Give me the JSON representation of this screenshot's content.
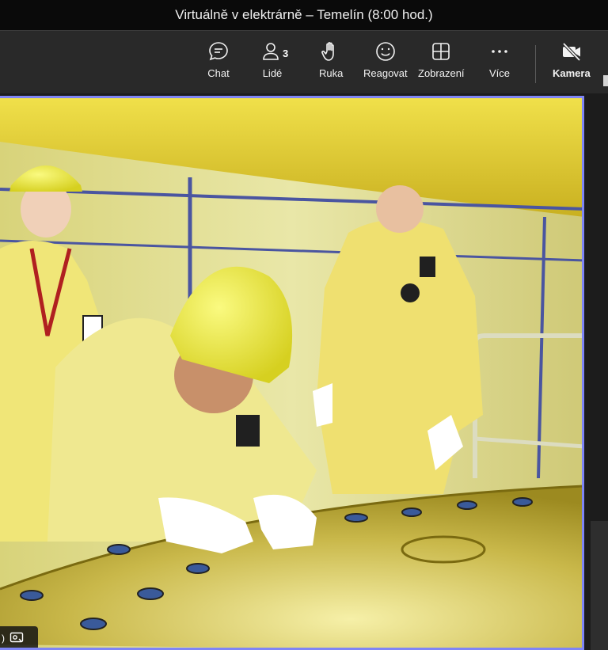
{
  "window": {
    "title": "Virtuálně v elektrárně – Temelín (8:00 hod.)"
  },
  "toolbar": {
    "chat": {
      "label": "Chat",
      "icon": "chat-icon"
    },
    "people": {
      "label": "Lidé",
      "count": "3",
      "icon": "people-icon"
    },
    "raise_hand": {
      "label": "Ruka",
      "icon": "hand-icon"
    },
    "react": {
      "label": "Reagovat",
      "icon": "smiley-icon"
    },
    "view": {
      "label": "Zobrazení",
      "icon": "grid-view-icon"
    },
    "more": {
      "label": "Více",
      "icon": "more-dots-icon"
    },
    "camera": {
      "label": "Kamera",
      "icon": "camera-off-icon"
    }
  },
  "colors": {
    "accent_border": "#7f85f5",
    "toolbar_bg": "#292929",
    "titlebar_bg": "#0a0a0a"
  }
}
